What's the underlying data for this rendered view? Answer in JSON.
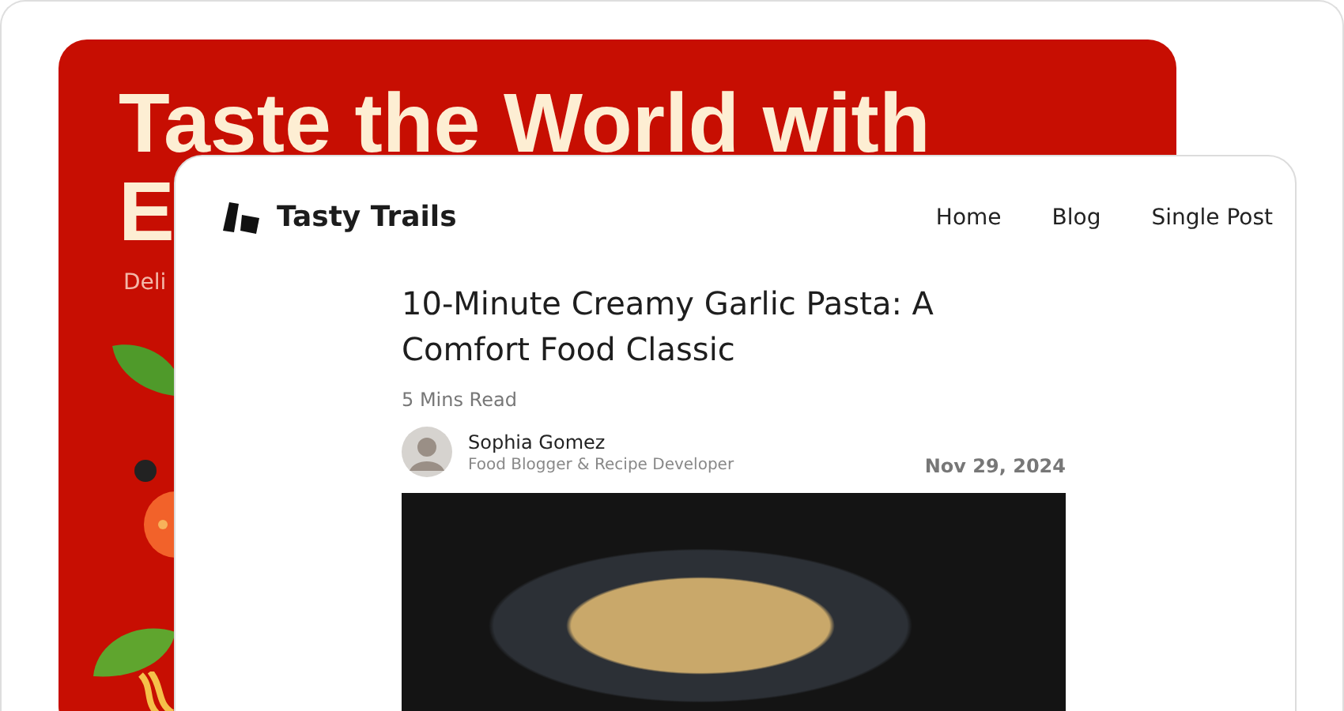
{
  "back_page": {
    "heading_line_1": "Taste the World with",
    "heading_line_2": "E",
    "subtitle": "Deli"
  },
  "site": {
    "brand": "Tasty Trails",
    "nav": [
      {
        "label": "Home"
      },
      {
        "label": "Blog"
      },
      {
        "label": "Single Post"
      }
    ]
  },
  "article": {
    "title": "10-Minute Creamy Garlic Pasta: A Comfort Food Classic",
    "read_time": "5 Mins Read",
    "author": {
      "name": "Sophia Gomez",
      "role": "Food Blogger & Recipe Developer"
    },
    "date": "Nov 29, 2024"
  }
}
